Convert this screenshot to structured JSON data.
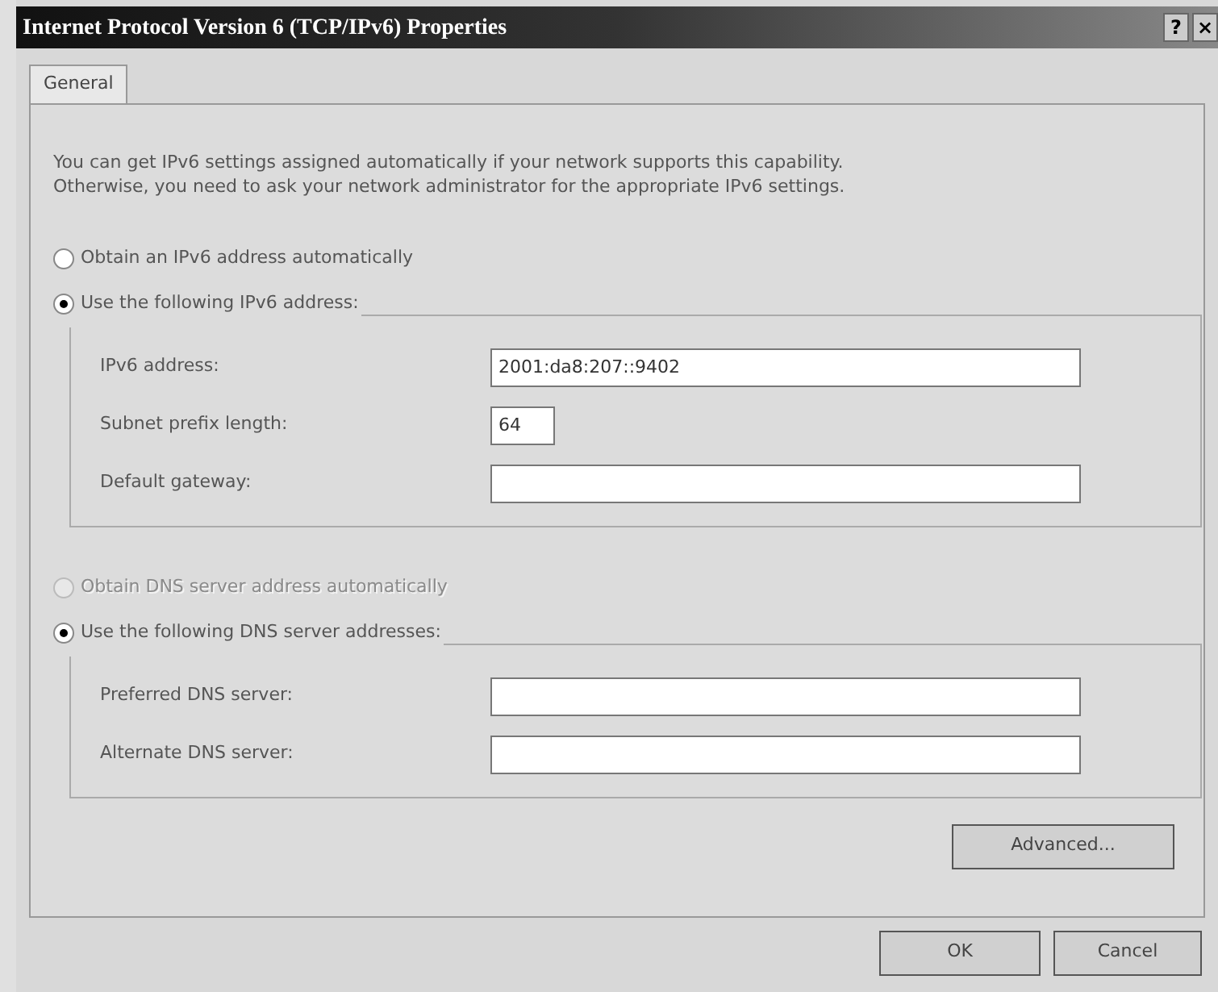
{
  "window": {
    "title": "Internet Protocol Version 6 (TCP/IPv6) Properties",
    "controls": [
      "?",
      "×"
    ]
  },
  "tabs": [
    {
      "label": "General",
      "selected": true
    }
  ],
  "intro": [
    "You can get IPv6 settings assigned automatically if your network supports this capability.",
    "Otherwise, you need to ask your network administrator for the appropriate IPv6 settings."
  ],
  "address_options": [
    {
      "label": "Obtain an IPv6 address automatically",
      "selected": false,
      "disabled": false
    },
    {
      "label": "Use the following IPv6 address:",
      "selected": true,
      "disabled": false
    }
  ],
  "address_fields": [
    {
      "label": "IPv6 address:",
      "value": "2001:da8:207::9402",
      "kind": "wide"
    },
    {
      "label": "Subnet prefix length:",
      "value": "64",
      "kind": "short"
    },
    {
      "label": "Default gateway:",
      "kind": "wide"
    }
  ],
  "dns_options": [
    {
      "label": "Obtain DNS server address automatically",
      "selected": false,
      "disabled": true
    },
    {
      "label": "Use the following DNS server addresses:",
      "selected": true,
      "disabled": false
    }
  ],
  "dns_fields": [
    {
      "label": "Preferred DNS server:",
      "kind": "wide"
    },
    {
      "label": "Alternate DNS server:",
      "kind": "wide"
    }
  ],
  "advanced_button": "Advanced...",
  "buttons": [
    "OK",
    "Cancel"
  ]
}
